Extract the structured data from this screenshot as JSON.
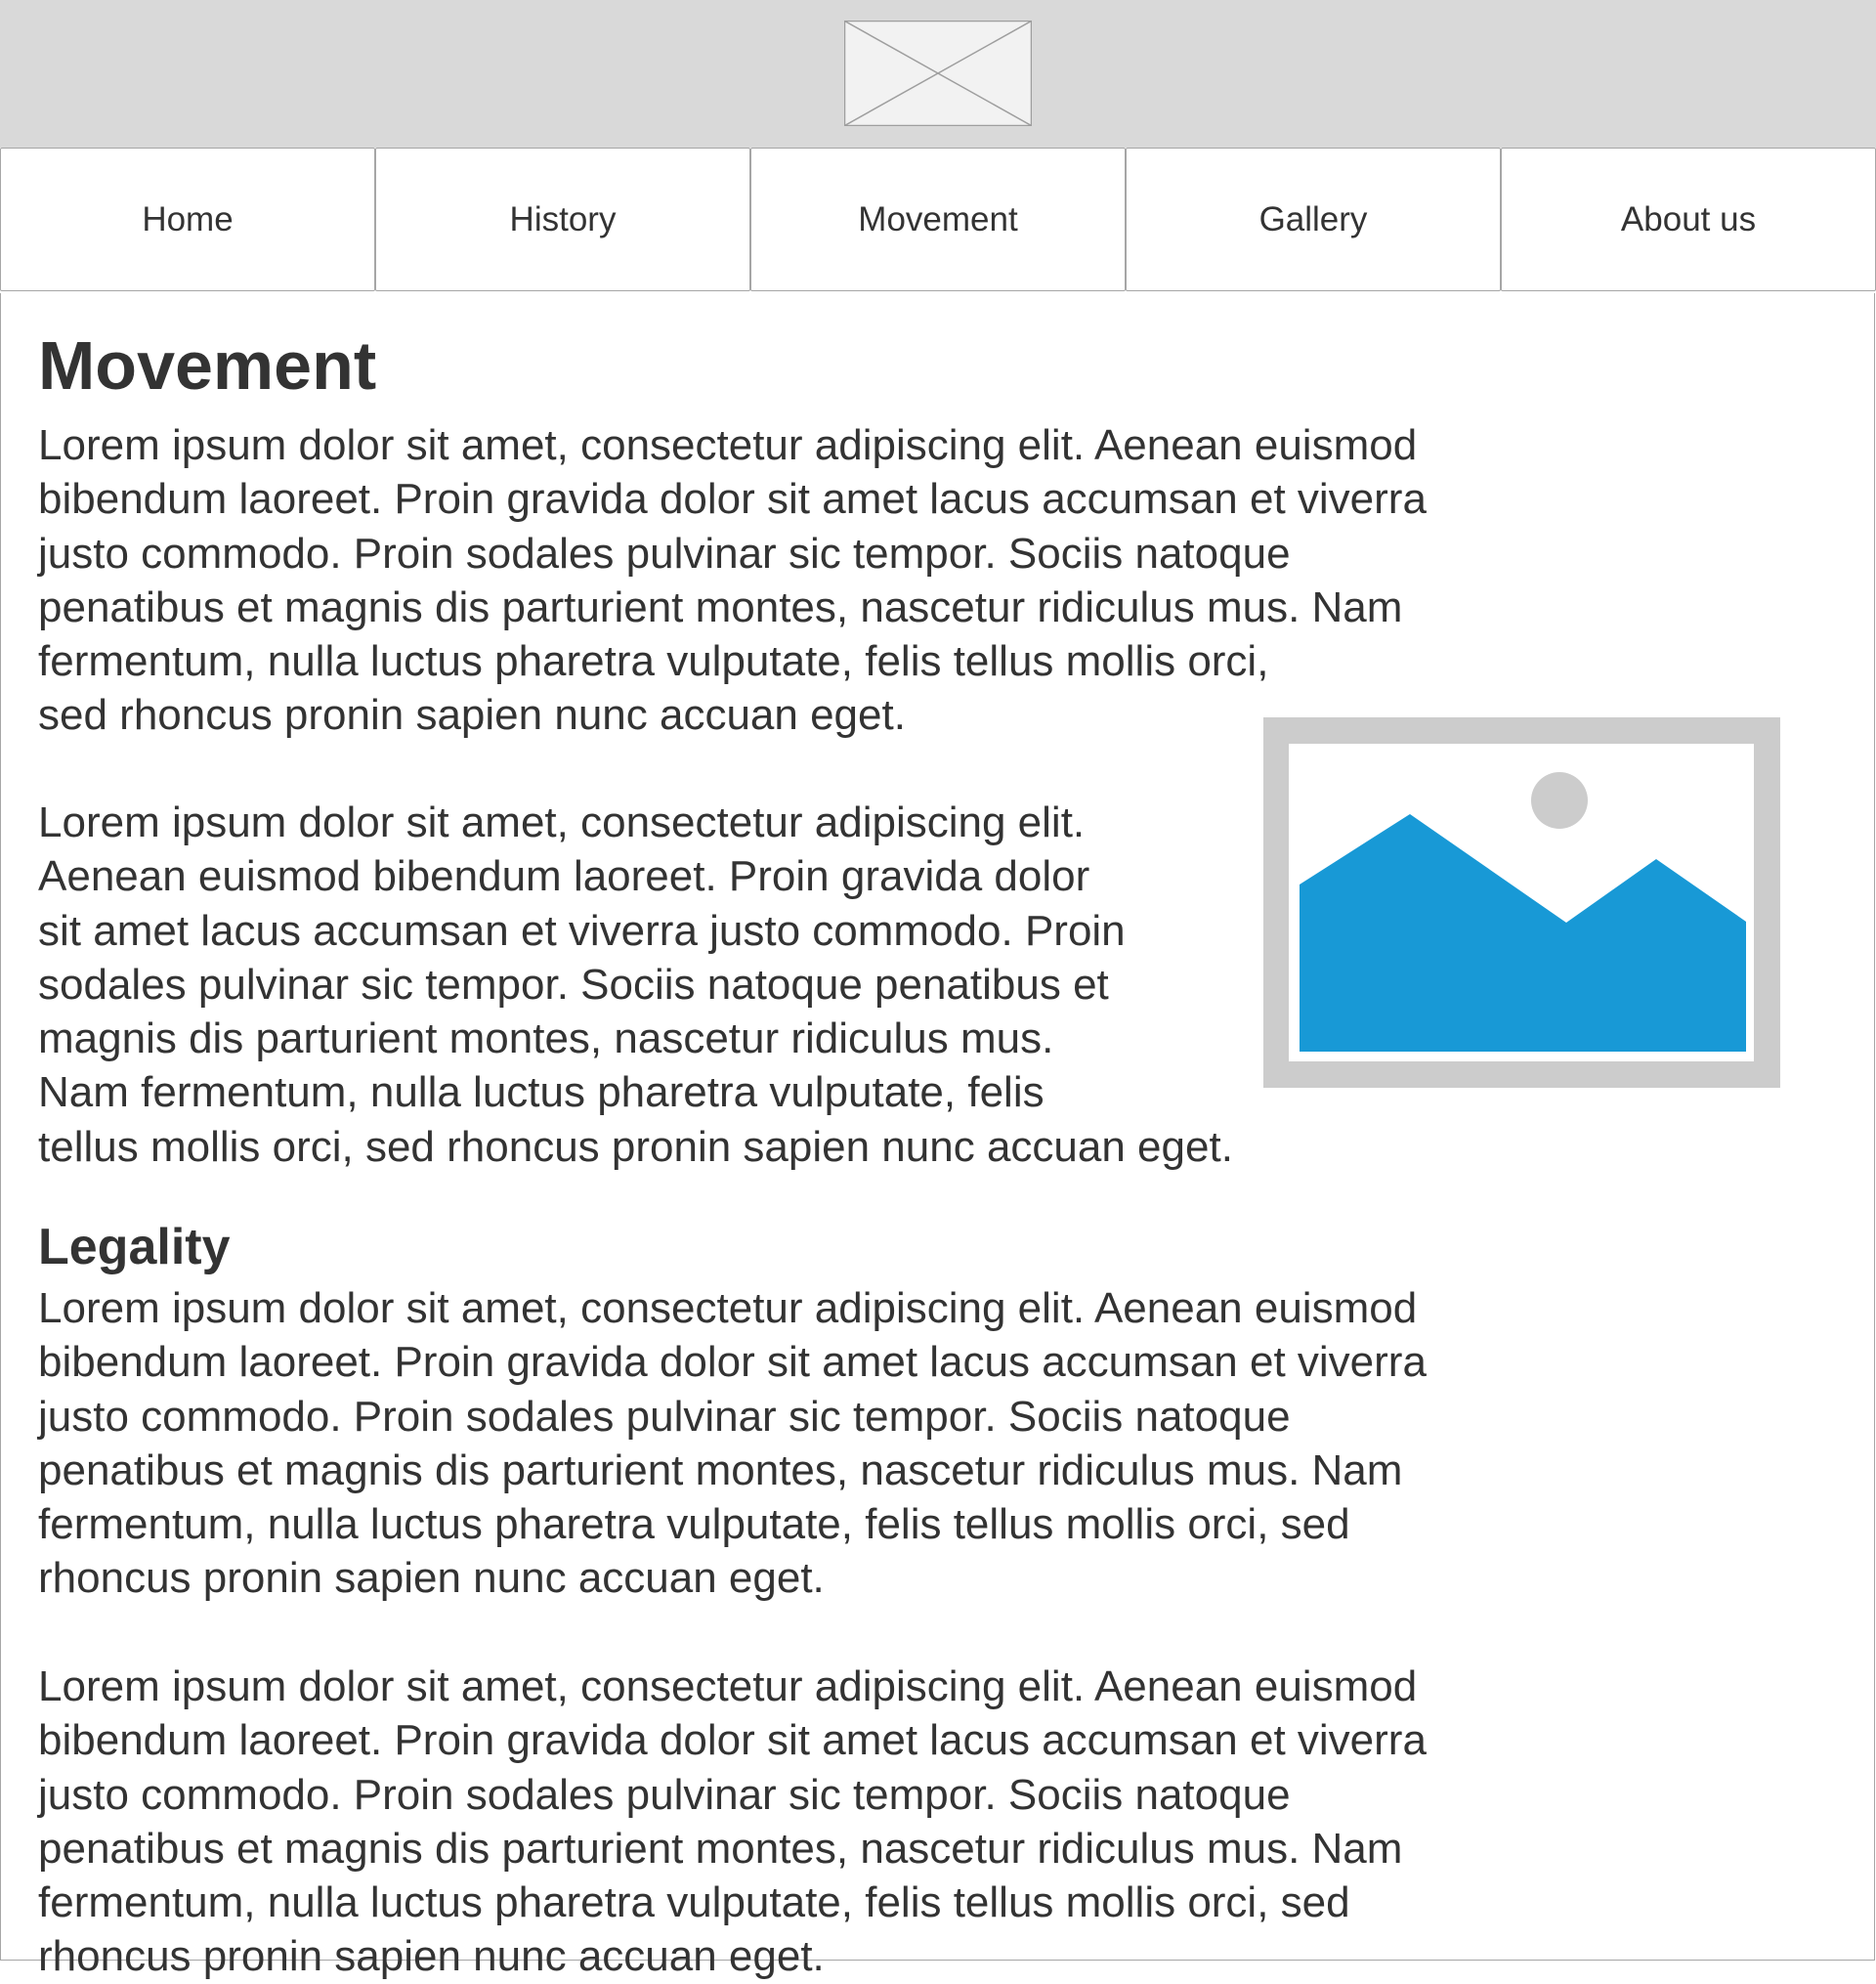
{
  "header": {
    "logo_icon": "image-placeholder-icon"
  },
  "nav": {
    "items": [
      {
        "label": "Home"
      },
      {
        "label": "History"
      },
      {
        "label": "Movement"
      },
      {
        "label": "Gallery"
      },
      {
        "label": "About us"
      }
    ]
  },
  "main": {
    "title": "Movement",
    "paragraph_1": "Lorem ipsum dolor sit amet, consectetur adipiscing elit. Aenean euismod\nbibendum laoreet. Proin gravida dolor sit amet lacus accumsan et viverra\njusto commodo. Proin sodales pulvinar sic tempor. Sociis natoque\npenatibus et magnis dis parturient montes, nascetur ridiculus mus. Nam\nfermentum, nulla luctus pharetra vulputate, felis tellus mollis orci,\n sed rhoncus pronin sapien nunc accuan eget.",
    "paragraph_2": "Lorem ipsum dolor sit amet, consectetur adipiscing elit.\nAenean euismod bibendum laoreet. Proin gravida dolor\nsit amet lacus accumsan et viverra justo commodo. Proin\nsodales pulvinar sic tempor. Sociis natoque penatibus et\nmagnis dis parturient montes, nascetur ridiculus mus.\nNam fermentum, nulla luctus pharetra vulputate, felis\ntellus mollis orci, sed rhoncus pronin sapien nunc accuan eget.",
    "image_icon": "landscape-image-icon",
    "section_title": "Legality",
    "paragraph_3": "Lorem ipsum dolor sit amet, consectetur adipiscing elit. Aenean euismod\nbibendum laoreet. Proin gravida dolor sit amet lacus accumsan et viverra\njusto commodo. Proin sodales pulvinar sic tempor. Sociis natoque\npenatibus et magnis dis parturient montes, nascetur ridiculus mus. Nam\nfermentum, nulla luctus pharetra vulputate, felis tellus mollis orci, sed\nrhoncus pronin sapien nunc accuan eget.",
    "paragraph_4": "Lorem ipsum dolor sit amet, consectetur adipiscing elit. Aenean euismod\nbibendum laoreet. Proin gravida dolor sit amet lacus accumsan et viverra\njusto commodo. Proin sodales pulvinar sic tempor. Sociis natoque\npenatibus et magnis dis parturient montes, nascetur ridiculus mus. Nam\nfermentum, nulla luctus pharetra vulputate, felis tellus mollis orci, sed\nrhoncus pronin sapien nunc accuan eget."
  },
  "colors": {
    "header_bg": "#d9d9d9",
    "text": "#333333",
    "border": "#a6a6a6",
    "image_frame": "#cccccc",
    "image_accent": "#1899d6"
  }
}
